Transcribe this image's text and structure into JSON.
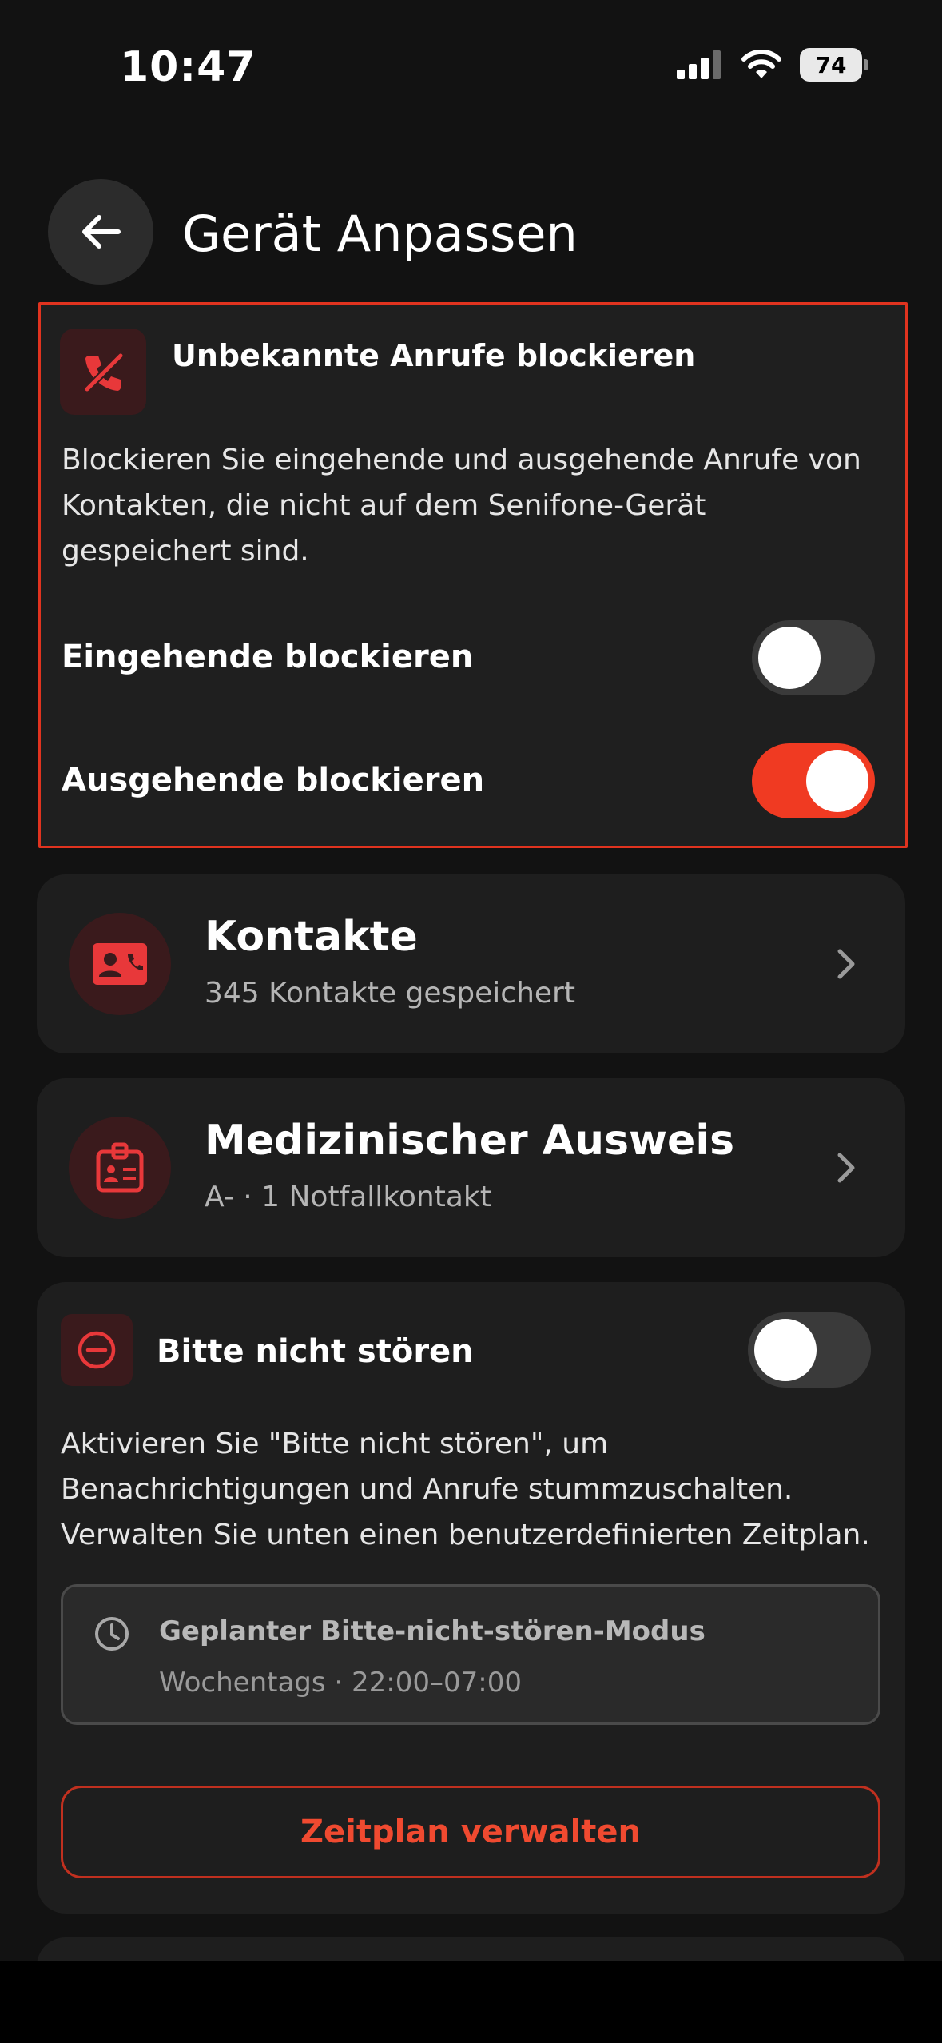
{
  "status_bar": {
    "time": "10:47",
    "battery": "74"
  },
  "header": {
    "title": "Gerät Anpassen"
  },
  "block_unknown": {
    "title": "Unbekannte Anrufe blockieren",
    "desc_lines": [
      "Blockieren Sie eingehende und ausgehende Anrufe von",
      "Kontakten, die nicht auf dem Senifone-Gerät",
      "gespeichert sind."
    ],
    "incoming_label": "Eingehende blockieren",
    "incoming_on": false,
    "outgoing_label": "Ausgehende blockieren",
    "outgoing_on": true
  },
  "contacts": {
    "title": "Kontakte",
    "subtitle": "345 Kontakte gespeichert"
  },
  "medical": {
    "title": "Medizinischer Ausweis",
    "subtitle": "A- · 1 Notfallkontakt"
  },
  "dnd": {
    "title": "Bitte nicht stören",
    "enabled": false,
    "desc_lines": [
      "Aktivieren Sie \"Bitte nicht stören\", um",
      "Benachrichtigungen und Anrufe stummzuschalten.",
      "Verwalten Sie unten einen benutzerdefinierten Zeitplan."
    ],
    "schedule_title": "Geplanter Bitte-nicht-stören-Modus",
    "schedule_sub": "Wochentags · 22:00–07:00",
    "manage_label": "Zeitplan verwalten"
  },
  "colors": {
    "accent": "#f03a22",
    "background": "#121212",
    "card": "#1e1e1e"
  }
}
